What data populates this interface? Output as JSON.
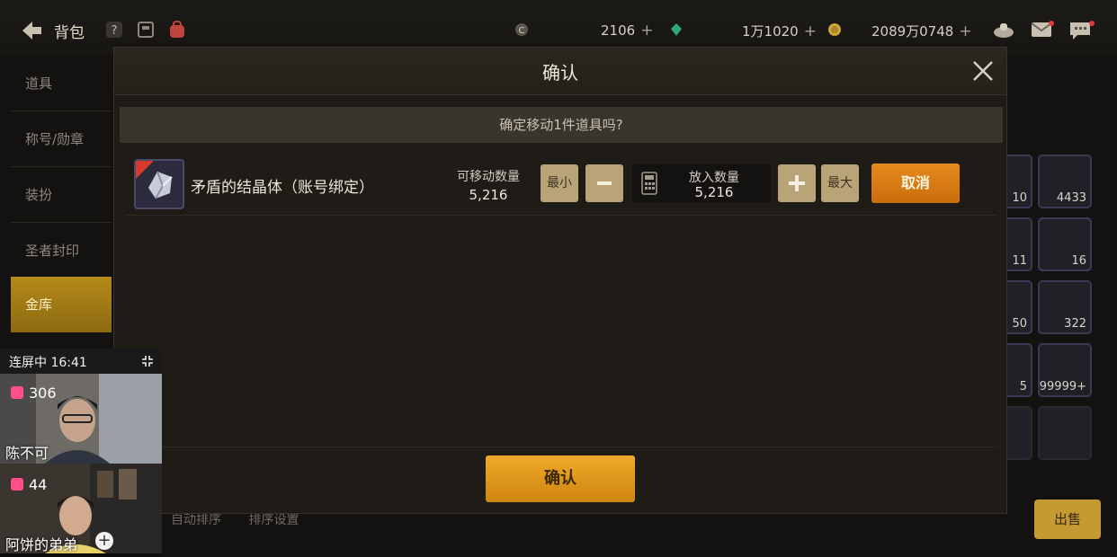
{
  "topbar": {
    "back_label": "背包",
    "currencies": [
      {
        "value": "2106",
        "plus": "+"
      },
      {
        "value": "1万1020",
        "plus": "+"
      },
      {
        "value": "2089万0748",
        "plus": "+"
      }
    ]
  },
  "leftnav": {
    "items": [
      {
        "label": "道具"
      },
      {
        "label": "称号/勋章"
      },
      {
        "label": "装扮"
      },
      {
        "label": "圣者封印"
      },
      {
        "label": "金库"
      }
    ],
    "active_index": 4
  },
  "grid": {
    "counts": [
      "10",
      "4433",
      "11",
      "16",
      "50",
      "322",
      "5",
      "99999+"
    ]
  },
  "bottom": {
    "auto_sort": "自动排序",
    "sort_settings": "排序设置",
    "sell": "出售"
  },
  "modal": {
    "title": "确认",
    "question": "确定移动1件道具吗?",
    "item": {
      "name": "矛盾的结晶体（账号绑定）",
      "badge": "账号"
    },
    "movable_label": "可移动数量",
    "movable_value": "5,216",
    "min_label": "最小",
    "max_label": "最大",
    "qty_label": "放入数量",
    "qty_value": "5,216",
    "cancel_label": "取消",
    "confirm_label": "确认"
  },
  "overlay": {
    "title": "连屏中 16:41",
    "streamers": [
      {
        "likes": "306",
        "name": "陈不可"
      },
      {
        "likes": "44",
        "name": "阿饼的弟弟"
      }
    ]
  },
  "colors": {
    "accent_orange": "#e58a1e",
    "gold": "#cf8510",
    "button_beige": "#b8a476"
  }
}
